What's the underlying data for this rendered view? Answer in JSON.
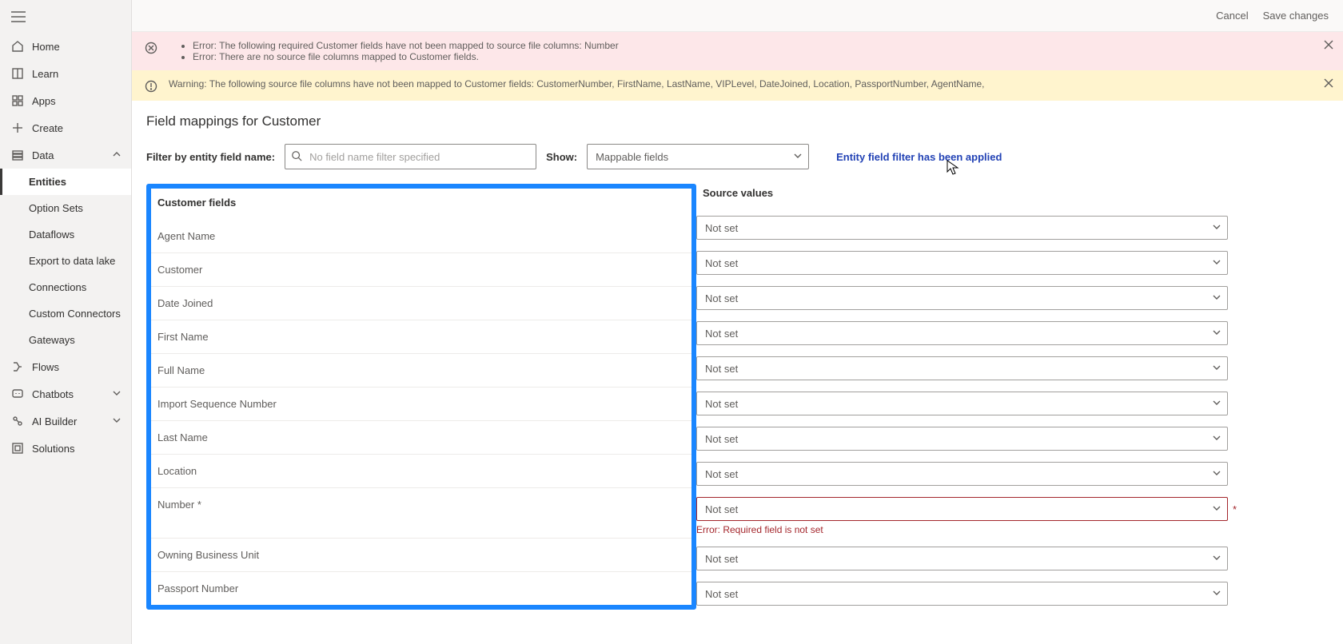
{
  "topbar": {
    "cancel": "Cancel",
    "save": "Save changes"
  },
  "sidebar": {
    "home": "Home",
    "learn": "Learn",
    "apps": "Apps",
    "create": "Create",
    "data": "Data",
    "entities": "Entities",
    "option_sets": "Option Sets",
    "dataflows": "Dataflows",
    "export_lake": "Export to data lake",
    "connections": "Connections",
    "custom_conn": "Custom Connectors",
    "gateways": "Gateways",
    "flows": "Flows",
    "chatbots": "Chatbots",
    "ai_builder": "AI Builder",
    "solutions": "Solutions"
  },
  "banners": {
    "error1": "Error: The following required Customer fields have not been mapped to source file columns: Number",
    "error2": "Error: There are no source file columns mapped to Customer fields.",
    "warning": "Warning: The following source file columns have not been mapped to Customer fields: CustomerNumber, FirstName, LastName, VIPLevel, DateJoined, Location, PassportNumber, AgentName,"
  },
  "page": {
    "title": "Field mappings for Customer",
    "filter_label": "Filter by entity field name:",
    "filter_placeholder": "No field name filter specified",
    "show_label": "Show:",
    "show_value": "Mappable fields",
    "applied_msg": "Entity field filter has been applied"
  },
  "headers": {
    "left": "Customer fields",
    "right": "Source values"
  },
  "fields": {
    "f0": "Agent Name",
    "f1": "Customer",
    "f2": "Date Joined",
    "f3": "First Name",
    "f4": "Full Name",
    "f5": "Import Sequence Number",
    "f6": "Last Name",
    "f7": "Location",
    "f8": "Number *",
    "f9": "Owning Business Unit",
    "f10": "Passport Number"
  },
  "values": {
    "notset": "Not set",
    "req_error": "Error: Required field is not set"
  }
}
